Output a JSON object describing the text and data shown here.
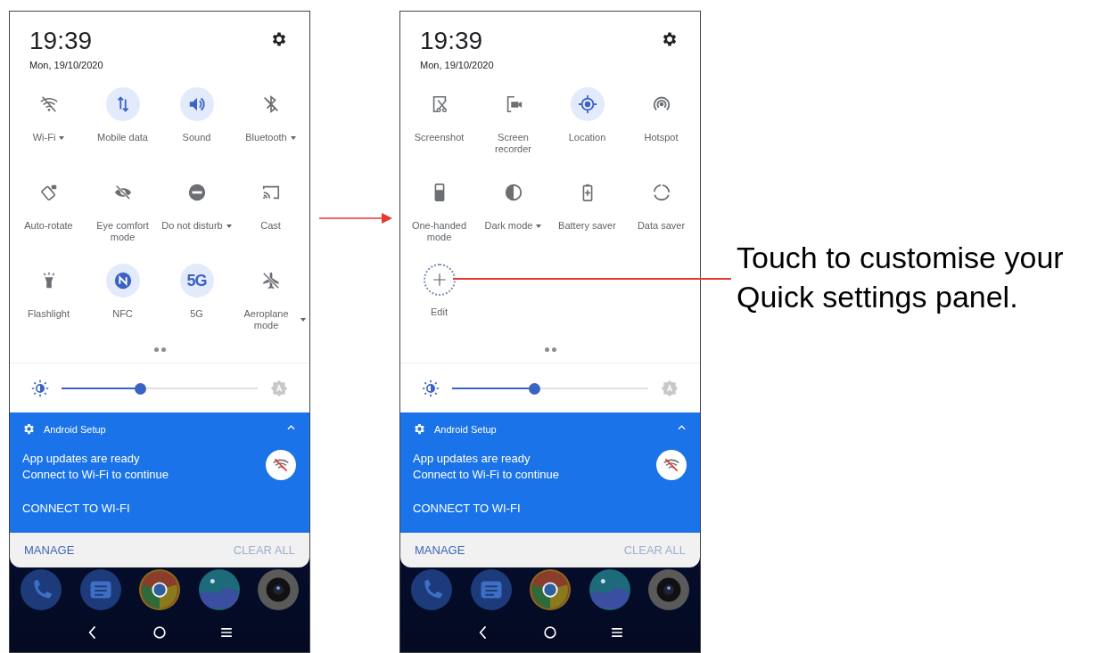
{
  "phones": [
    {
      "time": "19:39",
      "date": "Mon, 19/10/2020",
      "tiles": [
        {
          "kind": "wifi",
          "label": "Wi-Fi",
          "active": false,
          "dropdown": true
        },
        {
          "kind": "data",
          "label": "Mobile data",
          "active": true,
          "dropdown": false
        },
        {
          "kind": "sound",
          "label": "Sound",
          "active": true,
          "dropdown": false
        },
        {
          "kind": "bluetooth",
          "label": "Bluetooth",
          "active": false,
          "dropdown": true
        },
        {
          "kind": "rotate",
          "label": "Auto-rotate",
          "active": false,
          "dropdown": false
        },
        {
          "kind": "eye",
          "label": "Eye comfort mode",
          "active": false,
          "dropdown": false
        },
        {
          "kind": "dnd",
          "label": "Do not disturb",
          "active": false,
          "dropdown": true
        },
        {
          "kind": "cast",
          "label": "Cast",
          "active": false,
          "dropdown": false
        },
        {
          "kind": "flashlight",
          "label": "Flashlight",
          "active": false,
          "dropdown": false
        },
        {
          "kind": "nfc",
          "label": "NFC",
          "active": true,
          "dropdown": false
        },
        {
          "kind": "text",
          "glyph": "5G",
          "label": "5G",
          "active": true,
          "dropdown": false
        },
        {
          "kind": "plane",
          "label": "Aeroplane mode",
          "active": false,
          "dropdown": true
        }
      ],
      "brightness": {
        "level": 0.4
      },
      "notification": {
        "app": "Android Setup",
        "title": "App updates are ready",
        "text": "Connect to Wi-Fi to continue",
        "action": "CONNECT TO WI-FI"
      },
      "footer": {
        "manage": "MANAGE",
        "clear_all": "CLEAR ALL"
      }
    },
    {
      "time": "19:39",
      "date": "Mon, 19/10/2020",
      "tiles": [
        {
          "kind": "screenshot",
          "label": "Screenshot",
          "active": false,
          "dropdown": false
        },
        {
          "kind": "recorder",
          "label": "Screen recorder",
          "active": false,
          "dropdown": false
        },
        {
          "kind": "location",
          "label": "Location",
          "active": true,
          "dropdown": false
        },
        {
          "kind": "hotspot",
          "label": "Hotspot",
          "active": false,
          "dropdown": false
        },
        {
          "kind": "onehand",
          "label": "One-handed mode",
          "active": false,
          "dropdown": false
        },
        {
          "kind": "dark",
          "label": "Dark mode",
          "active": false,
          "dropdown": true
        },
        {
          "kind": "battery",
          "label": "Battery saver",
          "active": false,
          "dropdown": false
        },
        {
          "kind": "datasaver",
          "label": "Data saver",
          "active": false,
          "dropdown": false
        },
        {
          "kind": "edit",
          "label": "Edit"
        }
      ],
      "brightness": {
        "level": 0.42
      },
      "notification": {
        "app": "Android Setup",
        "title": "App updates are ready",
        "text": "Connect to Wi-Fi to continue",
        "action": "CONNECT TO WI-FI"
      },
      "footer": {
        "manage": "MANAGE",
        "clear_all": "CLEAR ALL"
      }
    }
  ],
  "callout": "Touch to customise your Quick settings panel."
}
